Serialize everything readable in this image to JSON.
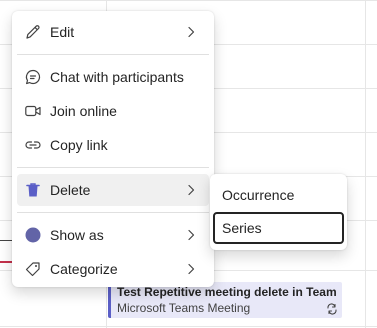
{
  "context_menu": {
    "items": [
      {
        "label": "Edit",
        "icon": "pencil-icon",
        "has_submenu": true
      },
      {
        "label": "Chat with participants",
        "icon": "chat-icon",
        "has_submenu": false
      },
      {
        "label": "Join online",
        "icon": "video-icon",
        "has_submenu": false
      },
      {
        "label": "Copy link",
        "icon": "link-icon",
        "has_submenu": false
      },
      {
        "label": "Delete",
        "icon": "trash-icon",
        "has_submenu": true,
        "active": true
      },
      {
        "label": "Show as",
        "icon": "status-dot-icon",
        "has_submenu": true
      },
      {
        "label": "Categorize",
        "icon": "tag-icon",
        "has_submenu": true
      }
    ]
  },
  "delete_submenu": {
    "items": [
      {
        "label": "Occurrence"
      },
      {
        "label": "Series",
        "focused": true
      }
    ]
  },
  "event": {
    "title": "Test Repetitive meeting delete in Teams",
    "subtitle": "Microsoft Teams Meeting",
    "icon": "repeat-icon"
  },
  "colors": {
    "accent": "#5b5fc7",
    "delete_icon": "#5b5fc7",
    "status_dot": "#6264a7",
    "event_bg": "#e8e8f8",
    "now_line": "#c4314b"
  }
}
